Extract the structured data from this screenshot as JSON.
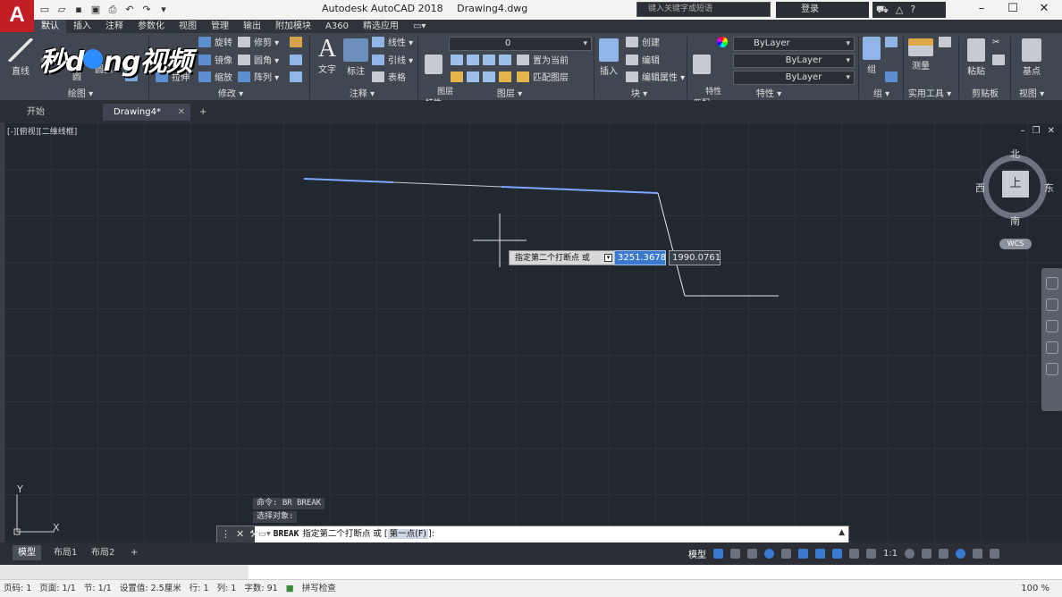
{
  "titlebar": {
    "app_logo": "A",
    "app_name": "Autodesk AutoCAD 2018",
    "file_name": "Drawing4.dwg",
    "search_placeholder": "键入关键字或短语",
    "signin_label": "登录"
  },
  "menu_tabs": [
    "默认",
    "插入",
    "注释",
    "参数化",
    "视图",
    "管理",
    "输出",
    "附加模块",
    "A360",
    "精选应用"
  ],
  "active_menu_tab": "默认",
  "ribbon": {
    "draw_panel": {
      "line": "直线",
      "polyline": "多段线",
      "circle": "圆",
      "arc": "圆弧",
      "label": "绘图 ▾"
    },
    "modify_panel": {
      "rotate": "旋转",
      "trim": "修剪",
      "mirror": "镜像",
      "fillet": "圆角",
      "stretch": "拉伸",
      "scale": "缩放",
      "array": "阵列",
      "label": "修改 ▾"
    },
    "annotation_panel": {
      "text": "文字",
      "dimension": "标注",
      "linear": "线性",
      "leader": "引线",
      "table": "表格",
      "label": "注释 ▾"
    },
    "layers_panel": {
      "layer_properties": "图层\n特性",
      "layer_value": "0",
      "make_current": "置为当前",
      "match_layer": "匹配图层",
      "label": "图层 ▾"
    },
    "block_panel": {
      "insert": "插入",
      "create": "创建",
      "edit": "编辑",
      "edit_attributes": "编辑属性",
      "label": "块 ▾"
    },
    "properties_panel": {
      "match_properties": "特性\n匹配",
      "color": "ByLayer",
      "linetype": "ByLayer",
      "lineweight": "ByLayer",
      "label": "特性 ▾"
    },
    "groups_panel": {
      "group": "组",
      "label": "组 ▾"
    },
    "utilities_panel": {
      "measure": "测量",
      "label": "实用工具 ▾"
    },
    "clipboard_panel": {
      "paste": "粘贴",
      "label": "剪贴板"
    },
    "view_panel": {
      "base": "基点",
      "label": "视图 ▾"
    }
  },
  "watermark": {
    "text_left": "秒d",
    "text_right": "ng视频"
  },
  "doc_tabs": [
    {
      "label": "开始"
    },
    {
      "label": "Drawing4*"
    }
  ],
  "canvas": {
    "viewport_label": "[-][俯视][二维线框]",
    "viewcube": {
      "north": "北",
      "south": "南",
      "west": "西",
      "east": "东",
      "top": "上",
      "wcs": "WCS"
    },
    "ucs": {
      "x": "X",
      "y": "Y"
    },
    "prompt": "指定第二个打断点 或",
    "input_x": "3251.3678",
    "input_y": "1990.0761"
  },
  "command": {
    "history": [
      "命令: BR BREAK",
      "选择对象:"
    ],
    "current_cmd": "BREAK",
    "prompt": "指定第二个打断点 或 [",
    "option": "第一点(F)",
    "prompt_end": "]:"
  },
  "layout_tabs": [
    "模型",
    "布局1",
    "布局2"
  ],
  "statusbar": {
    "model": "模型",
    "scale": "1:1"
  },
  "wordbar": {
    "items": [
      "页码: 1",
      "页面: 1/1",
      "节: 1/1",
      "设置值: 2.5厘米",
      "行: 1",
      "列: 1",
      "字数: 91",
      "拼写检查"
    ],
    "zoom": "100 %"
  },
  "colors": {
    "accent": "#3b79d1",
    "canvas_bg": "#212830",
    "ribbon_bg": "#414750",
    "brand_red": "#c21e26",
    "selected_line": "#7ea8ff"
  }
}
